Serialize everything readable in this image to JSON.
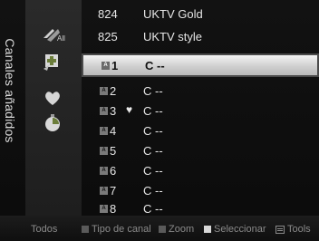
{
  "panel": {
    "title": "Canales añadidos"
  },
  "icons": {
    "all_label": "All",
    "names": [
      "all-channels-icon",
      "added-channels-icon",
      "favorites-icon",
      "timer-icon"
    ]
  },
  "channels": [
    {
      "num": "824",
      "name": "UKTV Gold",
      "badge": "",
      "heart": false
    },
    {
      "num": "825",
      "name": "UKTV style",
      "badge": "",
      "heart": false
    },
    {
      "num": "1",
      "name": "C --",
      "badge": "A",
      "heart": false,
      "selected": true
    },
    {
      "num": "2",
      "name": "C --",
      "badge": "A",
      "heart": false
    },
    {
      "num": "3",
      "name": "C --",
      "badge": "A",
      "heart": true
    },
    {
      "num": "4",
      "name": "C --",
      "badge": "A",
      "heart": false
    },
    {
      "num": "5",
      "name": "C --",
      "badge": "A",
      "heart": false
    },
    {
      "num": "6",
      "name": "C --",
      "badge": "A",
      "heart": false
    },
    {
      "num": "7",
      "name": "C --",
      "badge": "A",
      "heart": false
    },
    {
      "num": "8",
      "name": "C --",
      "badge": "A",
      "heart": false
    }
  ],
  "bottom_bar": {
    "mode": "Todos",
    "channel_type": "Tipo de canal",
    "zoom": "Zoom",
    "select": "Seleccionar",
    "tools": "Tools"
  }
}
